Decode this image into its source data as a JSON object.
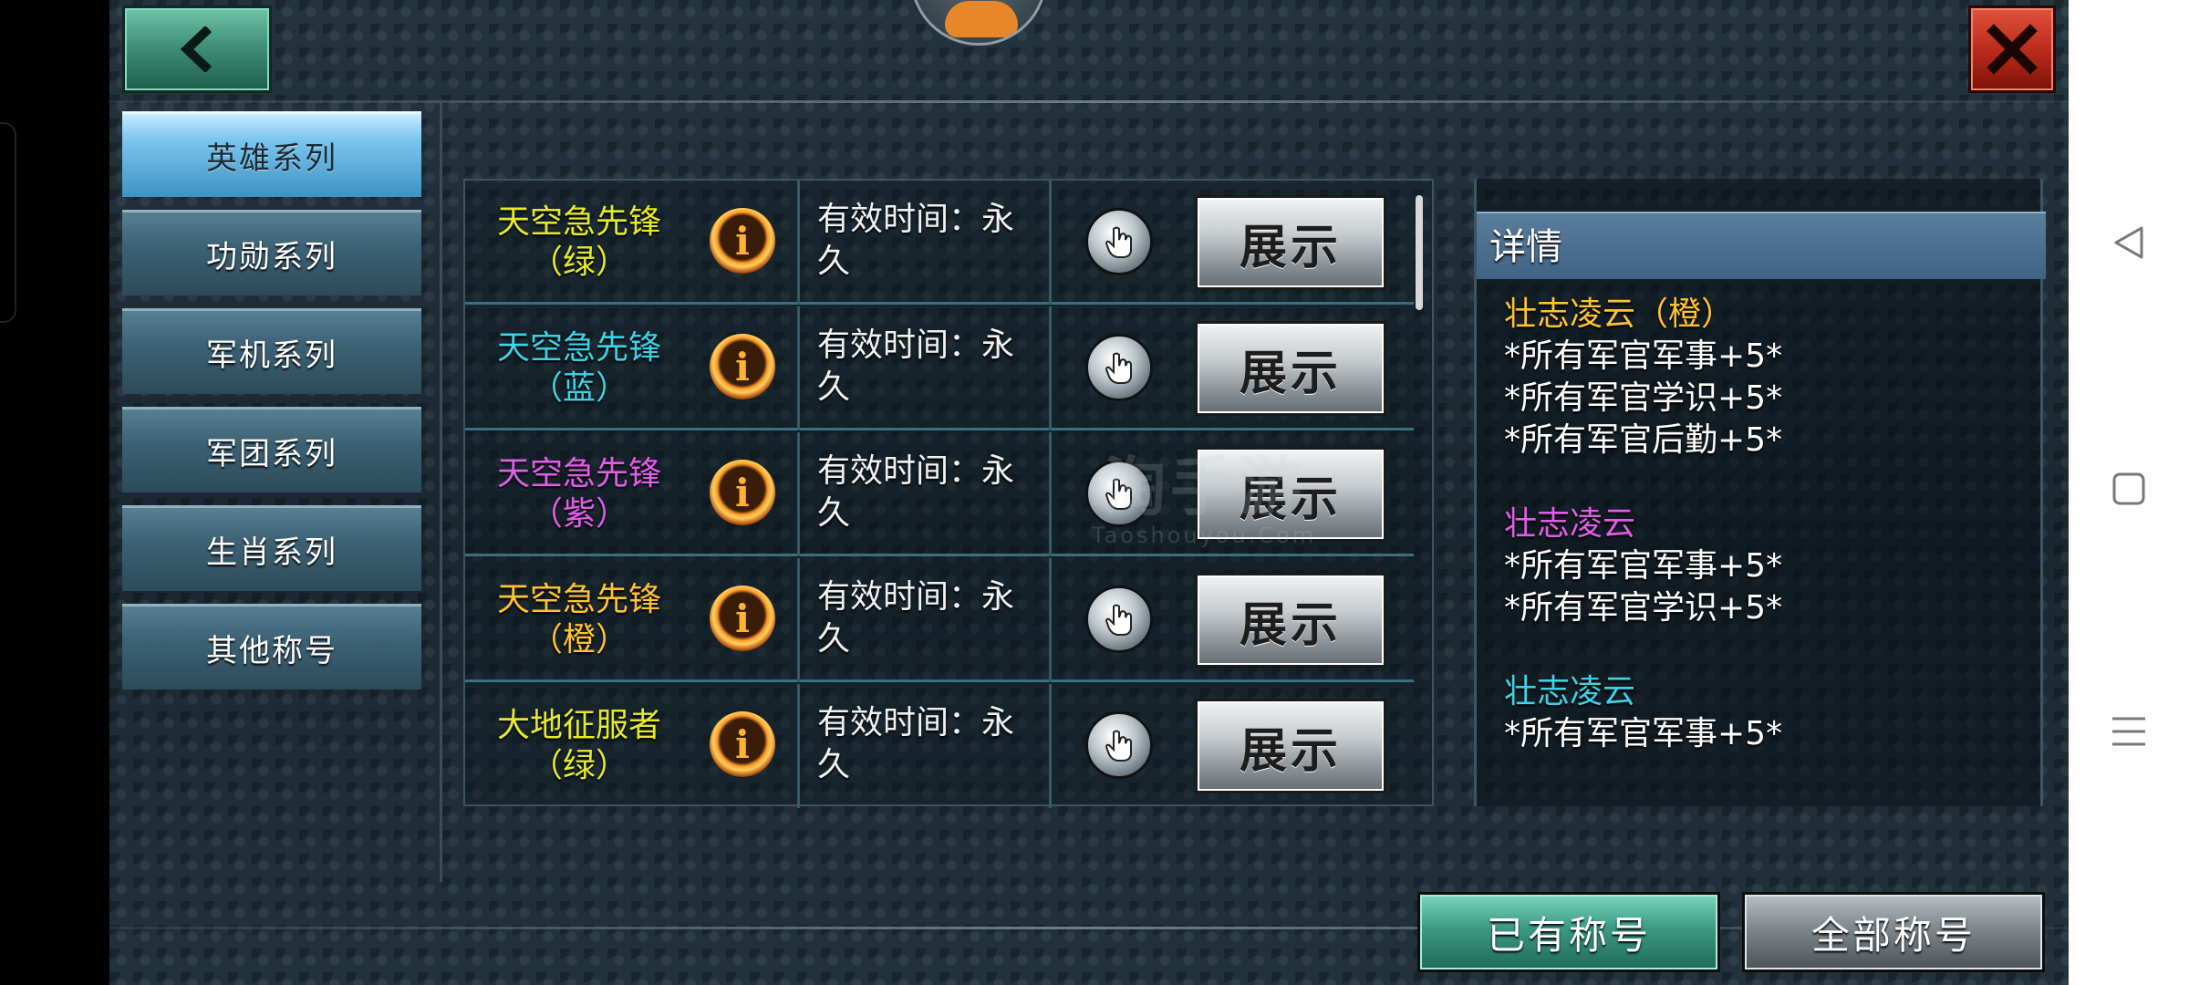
{
  "sidebar": {
    "items": [
      {
        "label": "英雄系列",
        "active": true
      },
      {
        "label": "功勋系列",
        "active": false
      },
      {
        "label": "军机系列",
        "active": false
      },
      {
        "label": "军团系列",
        "active": false
      },
      {
        "label": "生肖系列",
        "active": false
      },
      {
        "label": "其他称号",
        "active": false
      }
    ]
  },
  "titles": {
    "rows": [
      {
        "name_line1": "天空急先锋",
        "name_line2": "（绿）",
        "color": "#e6ea2a",
        "time_line1": "有效时间：永",
        "time_line2": "久",
        "button": "展示"
      },
      {
        "name_line1": "天空急先锋",
        "name_line2": "（蓝）",
        "color": "#3fd2e6",
        "time_line1": "有效时间：永",
        "time_line2": "久",
        "button": "展示"
      },
      {
        "name_line1": "天空急先锋",
        "name_line2": "（紫）",
        "color": "#e05ee8",
        "time_line1": "有效时间：永",
        "time_line2": "久",
        "button": "展示"
      },
      {
        "name_line1": "天空急先锋",
        "name_line2": "（橙）",
        "color": "#ffc42e",
        "time_line1": "有效时间：永",
        "time_line2": "久",
        "button": "展示"
      },
      {
        "name_line1": "大地征服者",
        "name_line2": "（绿）",
        "color": "#e6ea2a",
        "time_line1": "有效时间：永",
        "time_line2": "久",
        "button": "展示"
      }
    ]
  },
  "watermark": {
    "line1": "淘手游",
    "line2": "Taoshouyou.Com"
  },
  "details": {
    "header": "详情",
    "groups": [
      {
        "title": "壮志凌云（橙）",
        "color": "#ffc42e",
        "lines": [
          "*所有军官军事+5*",
          "*所有军官学识+5*",
          "*所有军官后勤+5*"
        ]
      },
      {
        "title": "壮志凌云",
        "color": "#e05ee8",
        "lines": [
          "*所有军官军事+5*",
          "*所有军官学识+5*"
        ]
      },
      {
        "title": "壮志凌云",
        "color": "#3fd2e6",
        "lines": [
          "*所有军官军事+5*"
        ]
      }
    ]
  },
  "tabs": {
    "owned": "已有称号",
    "all": "全部称号"
  }
}
